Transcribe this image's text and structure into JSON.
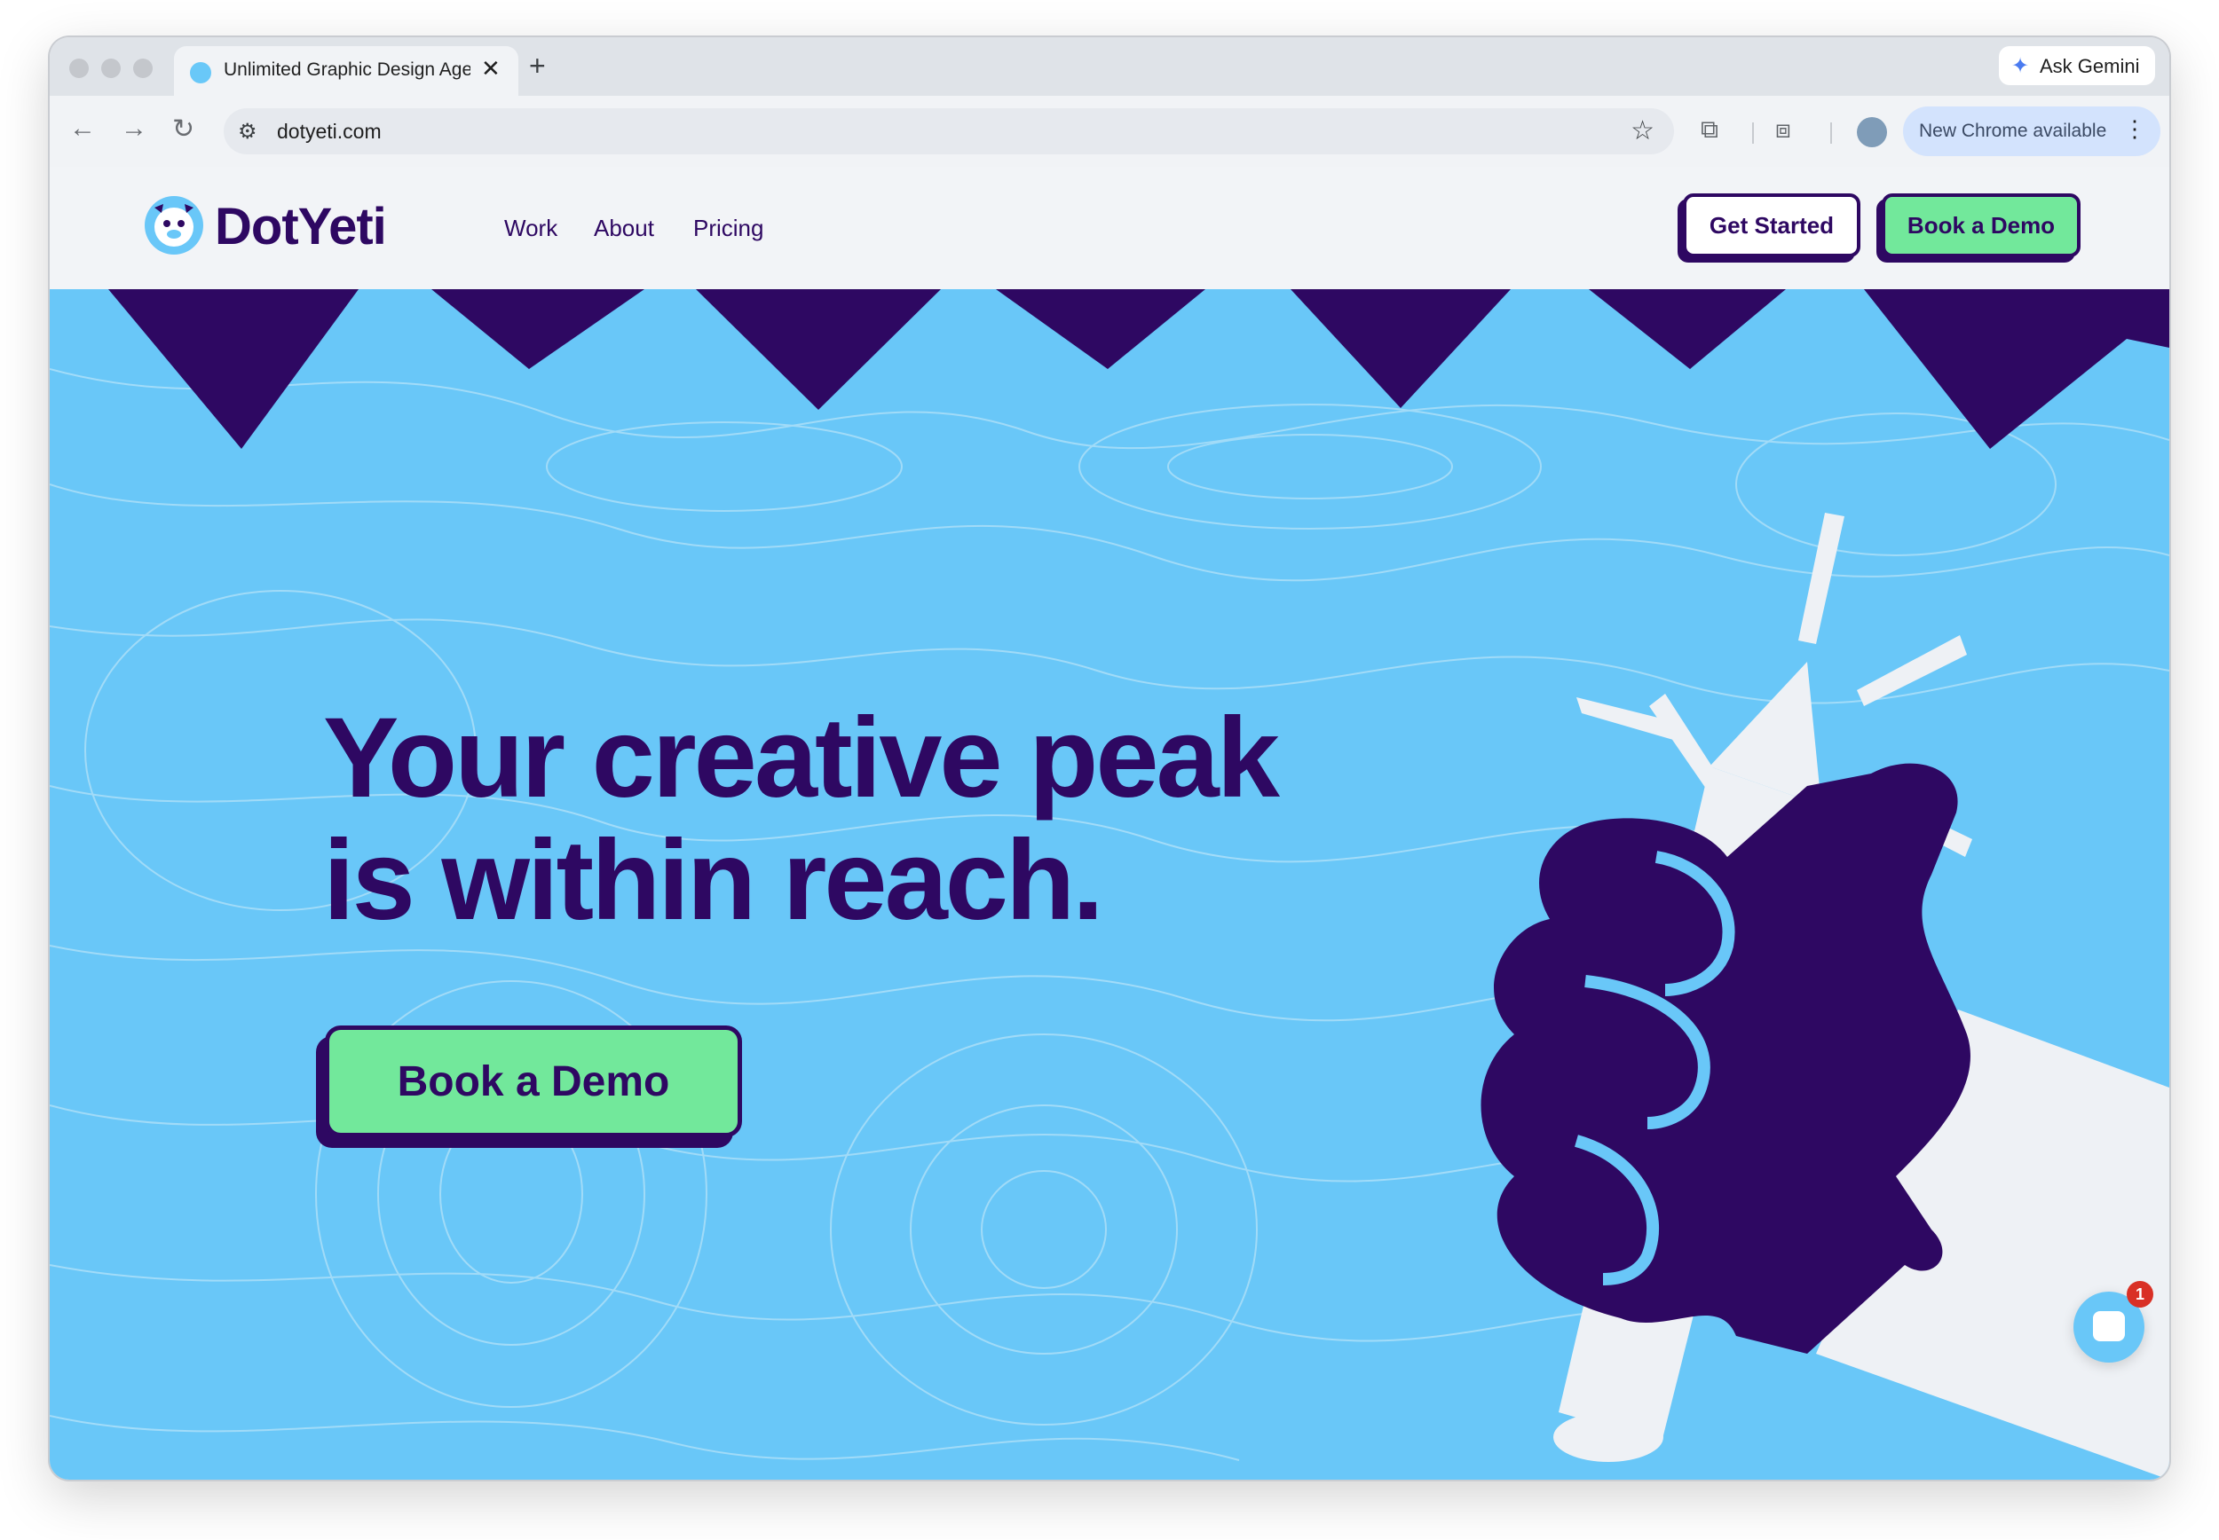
{
  "browser": {
    "tab_title": "Unlimited Graphic Design Agency",
    "tab_close_glyph": "✕",
    "new_tab_glyph": "+",
    "gemini_label": "Ask Gemini",
    "url": "dotyeti.com",
    "update_label": "New Chrome available",
    "icons": {
      "back": "←",
      "forward": "→",
      "reload": "↻",
      "site_info": "⚙",
      "bookmark": "☆",
      "extensions": "⧉",
      "cast": "⧈",
      "menu": "⋮",
      "gemini": "✦"
    }
  },
  "site": {
    "brand": "DotYeti",
    "nav": [
      {
        "label": "Work"
      },
      {
        "label": "About"
      },
      {
        "label": "Pricing"
      }
    ],
    "get_started_label": "Get Started",
    "book_demo_label": "Book a Demo"
  },
  "hero": {
    "headline_line1": "Your creative peak",
    "headline_line2": "is within reach.",
    "cta_label": "Book a Demo"
  },
  "chat": {
    "badge_count": "1"
  },
  "colors": {
    "brand_purple": "#2e0862",
    "hero_blue": "#69c7f8",
    "cta_green": "#72e89b",
    "header_bg": "#f2f4f7",
    "hand_white": "#eef1f5"
  }
}
